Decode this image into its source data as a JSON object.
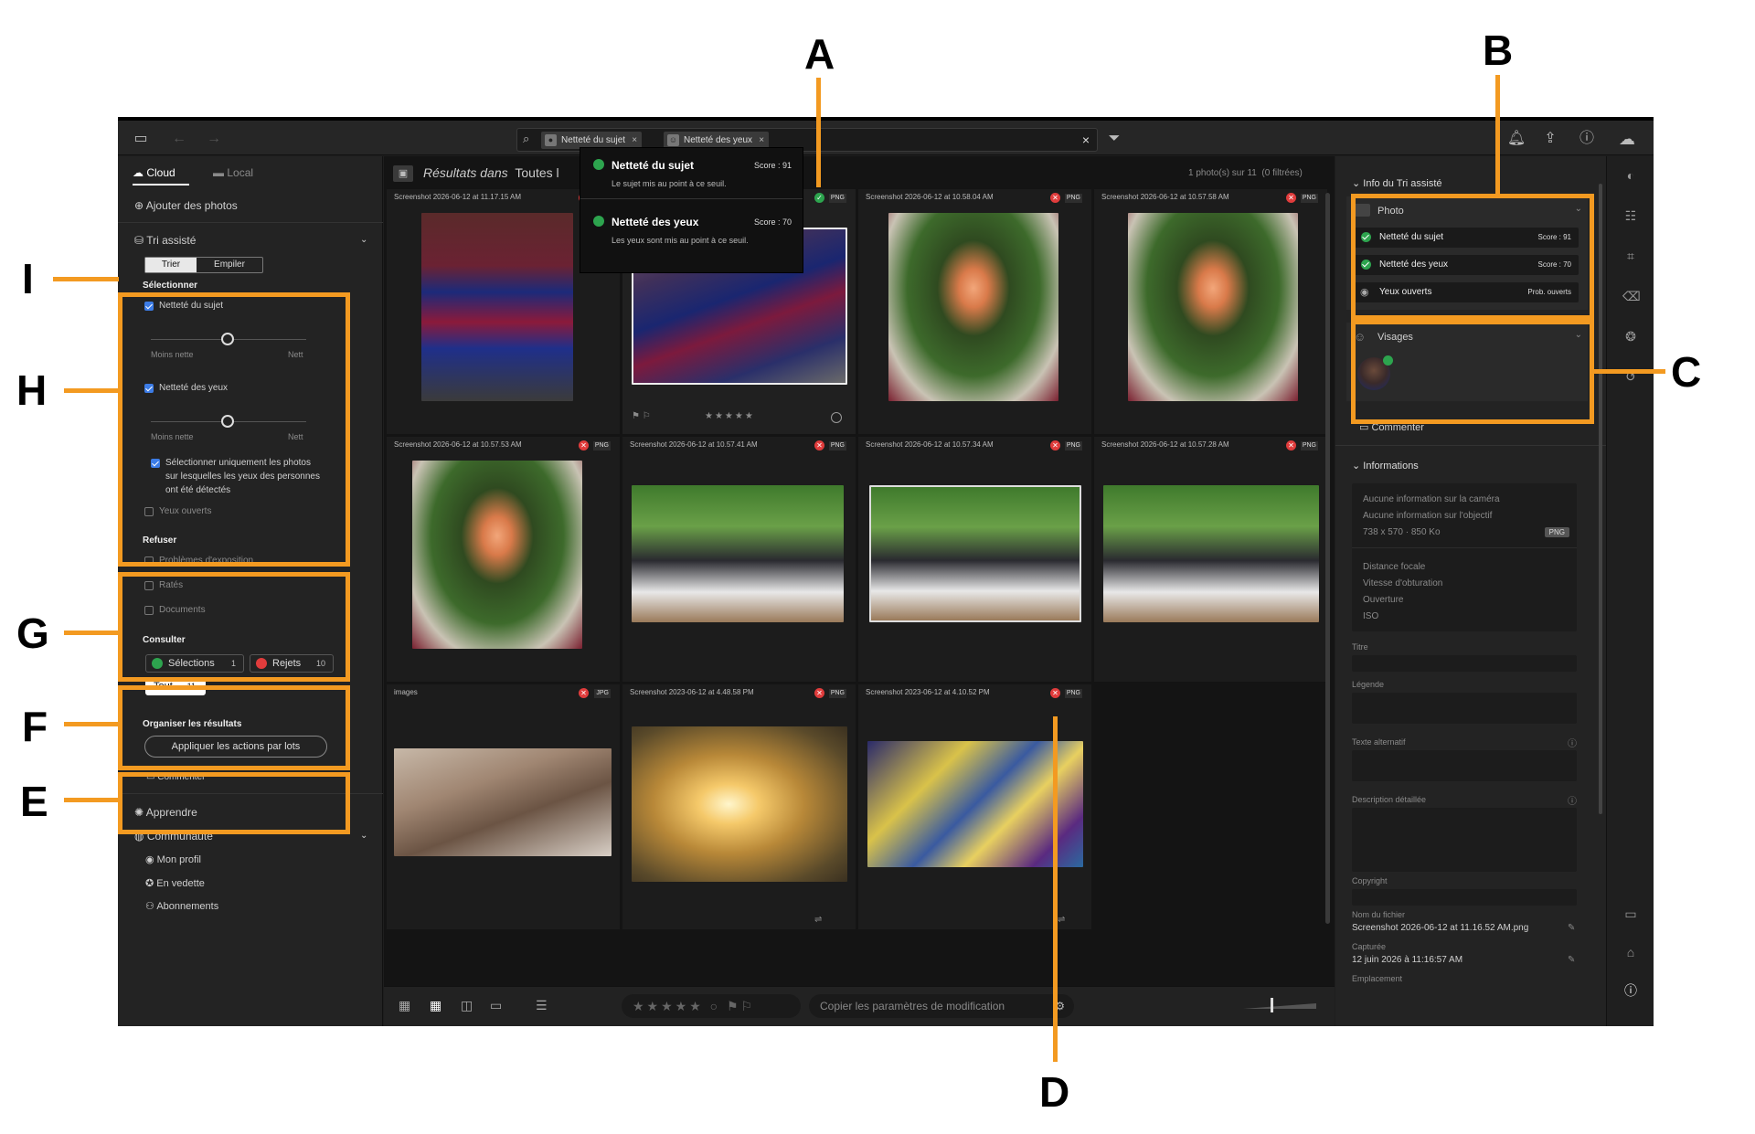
{
  "topbar": {
    "search_chips": [
      "Netteté du sujet",
      "Netteté des yeux"
    ]
  },
  "left": {
    "tabs": [
      "Cloud",
      "Local"
    ],
    "add_photos": "Ajouter des photos",
    "assisted_title": "Tri assisté",
    "mode_buttons": [
      "Trier",
      "Empiler"
    ],
    "select_title": "Sélectionner",
    "subject_sharp": "Netteté du sujet",
    "eye_sharp": "Netteté des yeux",
    "slider_min": "Moins nette",
    "slider_max": "Nett",
    "eyes_only_line1": "Sélectionner uniquement les photos",
    "eyes_only_line2": "sur lesquelles les yeux des personnes",
    "eyes_only_line3": "ont été détectés",
    "eyes_open": "Yeux ouverts",
    "refuse_title": "Refuser",
    "refuse_items": [
      "Problèmes d'exposition",
      "Ratés",
      "Documents"
    ],
    "consult_title": "Consulter",
    "selections": "Sélections",
    "selections_count": "1",
    "rejects": "Rejets",
    "rejects_count": "10",
    "all": "Tout",
    "all_count": "11",
    "organize_title": "Organiser les résultats",
    "batch_button": "Appliquer les actions par lots",
    "comment": "Commenter",
    "learn": "Apprendre",
    "community": "Communauté",
    "my_profile": "Mon profil",
    "featured": "En vedette",
    "subscriptions": "Abonnements"
  },
  "center": {
    "results_label": "Résultats dans",
    "results_scope": "Toutes l",
    "count_text": "1 photo(s) sur 11",
    "filtered_text": "(0 filtrées)",
    "tooltip": {
      "item1_title": "Netteté du sujet",
      "item1_score": "Score : 91",
      "item1_desc": "Le sujet mis au point à ce seuil.",
      "item2_title": "Netteté des yeux",
      "item2_score": "Score : 70",
      "item2_desc": "Les yeux sont mis au point à ce seuil."
    },
    "photos": [
      {
        "name": "Screenshot 2026-06-12 at 11.17.15 AM",
        "type": "PNG",
        "status": "reject"
      },
      {
        "name": "",
        "type": "PNG",
        "status": "pick"
      },
      {
        "name": "Screenshot 2026-06-12 at 10.58.04 AM",
        "type": "PNG",
        "status": "reject"
      },
      {
        "name": "Screenshot 2026-06-12 at 10.57.58 AM",
        "type": "PNG",
        "status": "reject"
      },
      {
        "name": "Screenshot 2026-06-12 at 10.57.53 AM",
        "type": "PNG",
        "status": "reject"
      },
      {
        "name": "Screenshot 2026-06-12 at 10.57.41 AM",
        "type": "PNG",
        "status": "reject"
      },
      {
        "name": "Screenshot 2026-06-12 at 10.57.34 AM",
        "type": "PNG",
        "status": "reject"
      },
      {
        "name": "Screenshot 2026-06-12 at 10.57.28 AM",
        "type": "PNG",
        "status": "reject"
      },
      {
        "name": "images",
        "type": "JPG",
        "status": "reject"
      },
      {
        "name": "Screenshot 2023-06-12 at 4.48.58 PM",
        "type": "PNG",
        "status": "reject"
      },
      {
        "name": "Screenshot 2023-06-12 at 4.10.52 PM",
        "type": "PNG",
        "status": "reject"
      }
    ],
    "copy_settings": "Copier les paramètres de modification"
  },
  "right": {
    "section_title": "Info du Tri assisté",
    "photo_label": "Photo",
    "rows": [
      {
        "label": "Netteté du sujet",
        "score": "Score : 91"
      },
      {
        "label": "Netteté des yeux",
        "score": "Score : 70"
      },
      {
        "label": "Yeux ouverts",
        "score": "Prob. ouverts"
      }
    ],
    "faces_label": "Visages",
    "comment": "Commenter",
    "info_title": "Informations",
    "no_camera": "Aucune information sur la caméra",
    "no_lens": "Aucune information sur l'objectif",
    "dims": "738 x 570",
    "size": "850 Ko",
    "file_type": "PNG",
    "focal": "Distance focale",
    "shutter": "Vitesse d'obturation",
    "aperture": "Ouverture",
    "iso": "ISO",
    "title_label": "Titre",
    "caption_label": "Légende",
    "alt_label": "Texte alternatif",
    "desc_label": "Description détaillée",
    "copyright_label": "Copyright",
    "filename_label": "Nom du fichier",
    "filename": "Screenshot 2026-06-12 at 11.16.52 AM.png",
    "captured_label": "Capturée",
    "captured": "12 juin 2026 à 11:16:57 AM",
    "location_label": "Emplacement"
  },
  "callouts": [
    "A",
    "B",
    "C",
    "D",
    "E",
    "F",
    "G",
    "H",
    "I"
  ],
  "colors": {
    "accent": "#f39a21",
    "pick": "#2da44e",
    "reject": "#e03c3c",
    "checkbox": "#3c7ce6"
  }
}
